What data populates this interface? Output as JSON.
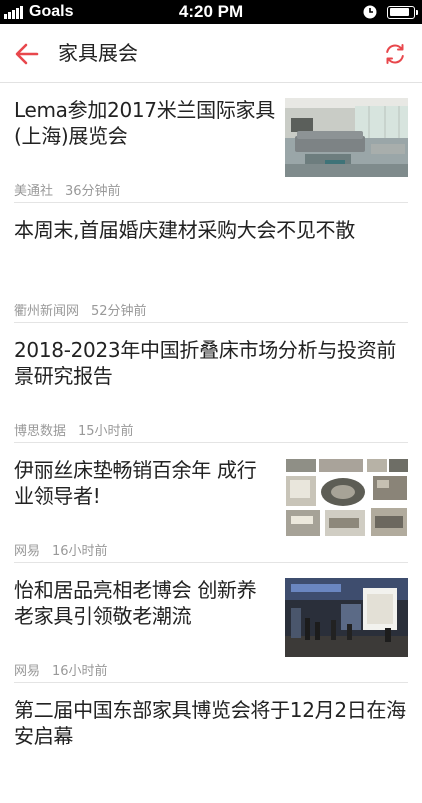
{
  "status_bar": {
    "carrier": "Goals",
    "time": "4:20 PM",
    "signal_icon": "signal-bars-icon",
    "wifi_icon": "wifi-icon",
    "alarm_icon": "clock-icon",
    "battery_icon": "battery-icon",
    "battery_level": 0.9
  },
  "nav": {
    "title": "家具展会",
    "back_icon": "back-arrow-icon",
    "refresh_icon": "refresh-icon",
    "accent_color": "#e8474c"
  },
  "articles": [
    {
      "title": "Lema参加2017米兰国际家具(上海)展览会",
      "source": "美通社",
      "time": "36分钟前",
      "thumbnail": "living-room-sofa"
    },
    {
      "title": "本周末,首届婚庆建材采购大会不见不散",
      "source": "衢州新闻网",
      "time": "52分钟前",
      "thumbnail": null
    },
    {
      "title": "2018-2023年中国折叠床市场分析与投资前景研究报告",
      "source": "博思数据",
      "time": "15小时前",
      "thumbnail": null
    },
    {
      "title": "伊丽丝床垫畅销百余年 成行业领导者!",
      "source": "网易",
      "time": "16小时前",
      "thumbnail": "photo-collage"
    },
    {
      "title": "怡和居品亮相老博会 创新养老家具引领敬老潮流",
      "source": "网易",
      "time": "16小时前",
      "thumbnail": "exhibition-hall"
    },
    {
      "title": "第二届中国东部家具博览会将于12月2日在海安启幕",
      "source": "",
      "time": "",
      "thumbnail": null
    }
  ]
}
